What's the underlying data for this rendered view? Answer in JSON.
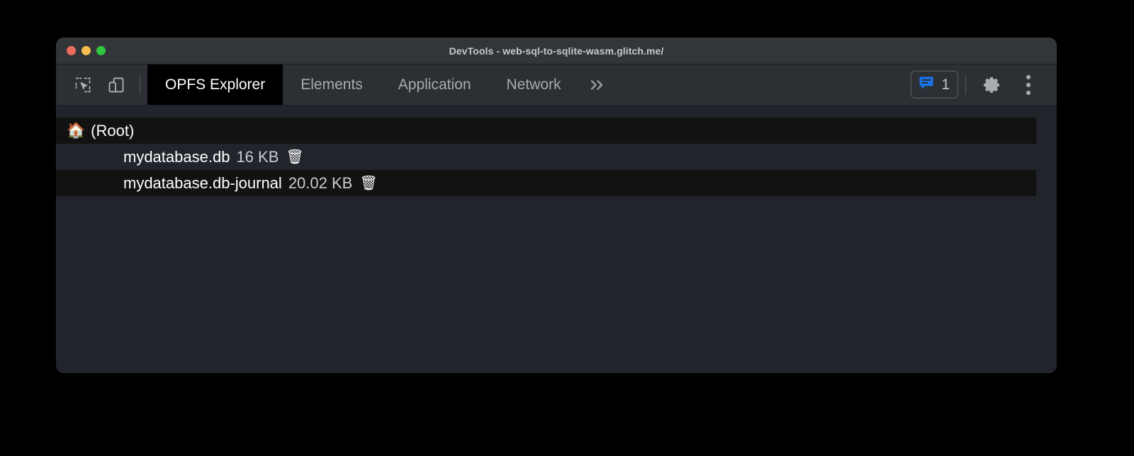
{
  "window": {
    "title": "DevTools - web-sql-to-sqlite-wasm.glitch.me/",
    "traffic_lights": [
      {
        "name": "close",
        "color": "#ed6a5e"
      },
      {
        "name": "minimize",
        "color": "#f5bd4f"
      },
      {
        "name": "maximize",
        "color": "#2fc840"
      }
    ]
  },
  "toolbar": {
    "inspect_icon": "inspect-element-icon",
    "device_icon": "device-toolbar-icon",
    "overflow_label": "»",
    "console_badge": {
      "icon": "console-message-icon",
      "count": "1"
    },
    "settings_icon": "gear-icon",
    "menu_icon": "more-options-icon"
  },
  "tabs": [
    {
      "label": "OPFS Explorer",
      "active": true
    },
    {
      "label": "Elements",
      "active": false
    },
    {
      "label": "Application",
      "active": false
    },
    {
      "label": "Network",
      "active": false
    }
  ],
  "file_tree": {
    "rows": [
      {
        "emoji": "🏠",
        "emoji_name": "house-icon",
        "name": "(Root)",
        "size": "",
        "delete": "",
        "depth": 0,
        "stripe": "dark"
      },
      {
        "emoji": "",
        "emoji_name": "",
        "name": "mydatabase.db",
        "size": "16 KB",
        "delete": "🗑",
        "depth": 1,
        "stripe": "light"
      },
      {
        "emoji": "",
        "emoji_name": "",
        "name": "mydatabase.db-journal",
        "size": "20.02 KB",
        "delete": "🗑",
        "depth": 1,
        "stripe": "dark"
      }
    ]
  },
  "colors": {
    "accent_blue": "#1a73e8",
    "window_chrome": "#323639",
    "tabbar": "#2c2f33",
    "panel_bg": "#21242b",
    "row_dark": "#121212"
  }
}
